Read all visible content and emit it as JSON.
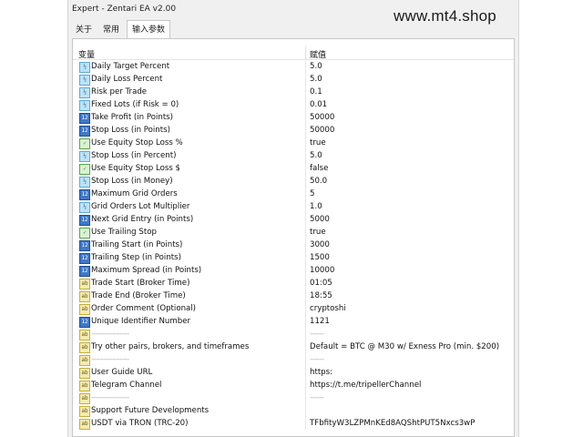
{
  "window": {
    "title": "Expert - Zentari EA v2.00"
  },
  "watermark": "www.mt4.shop",
  "tabs": [
    {
      "label": "关于"
    },
    {
      "label": "常用"
    },
    {
      "label": "输入参数"
    }
  ],
  "table": {
    "header": {
      "variable": "变量",
      "value": "赋值"
    },
    "rows": [
      {
        "icon": "double-icon",
        "name": "Daily Target Percent",
        "value": "5.0"
      },
      {
        "icon": "double-icon",
        "name": "Daily Loss Percent",
        "value": "5.0"
      },
      {
        "icon": "double-icon",
        "name": "Risk per Trade",
        "value": "0.1"
      },
      {
        "icon": "double-icon",
        "name": "Fixed Lots (if Risk = 0)",
        "value": "0.01"
      },
      {
        "icon": "integer-icon",
        "name": "Take Profit (in Points)",
        "value": "50000"
      },
      {
        "icon": "integer-icon",
        "name": "Stop Loss (in Points)",
        "value": "50000"
      },
      {
        "icon": "bool-icon",
        "name": "Use Equity Stop Loss %",
        "value": "true"
      },
      {
        "icon": "double-icon",
        "name": "Stop Loss (in Percent)",
        "value": "5.0"
      },
      {
        "icon": "bool-icon",
        "name": "Use Equity Stop Loss $",
        "value": "false"
      },
      {
        "icon": "double-icon",
        "name": "Stop Loss (in Money)",
        "value": "50.0"
      },
      {
        "icon": "integer-icon",
        "name": "Maximum Grid Orders",
        "value": "5"
      },
      {
        "icon": "double-icon",
        "name": "Grid Orders Lot Multiplier",
        "value": "1.0"
      },
      {
        "icon": "integer-icon",
        "name": "Next Grid Entry (in Points)",
        "value": "5000"
      },
      {
        "icon": "bool-icon",
        "name": "Use Trailing Stop",
        "value": "true"
      },
      {
        "icon": "integer-icon",
        "name": "Trailing Start (in Points)",
        "value": "3000"
      },
      {
        "icon": "integer-icon",
        "name": "Trailing Step (in Points)",
        "value": "1500"
      },
      {
        "icon": "integer-icon",
        "name": "Maximum Spread (in Points)",
        "value": "10000"
      },
      {
        "icon": "string-icon",
        "name": "Trade Start (Broker Time)",
        "value": "01:05"
      },
      {
        "icon": "string-icon",
        "name": "Trade End (Broker Time)",
        "value": "18:55"
      },
      {
        "icon": "string-icon",
        "name": "Order Comment (Optional)",
        "value": "cryptoshi"
      },
      {
        "icon": "integer-icon",
        "name": "Unique Identifier Number",
        "value": "1121"
      },
      {
        "icon": "string-icon",
        "name": "----------------",
        "value": "------"
      },
      {
        "icon": "string-icon",
        "name": "Try other pairs, brokers, and timeframes",
        "value": "Default = BTC @ M30 w/ Exness Pro (min. $200)"
      },
      {
        "icon": "string-icon",
        "name": "----------------",
        "value": "------"
      },
      {
        "icon": "string-icon",
        "name": "User Guide URL",
        "value": "https:"
      },
      {
        "icon": "string-icon",
        "name": "Telegram Channel",
        "value": "https://t.me/tripellerChannel"
      },
      {
        "icon": "string-icon",
        "name": "----------------",
        "value": "------"
      },
      {
        "icon": "string-icon",
        "name": "Support Future Developments",
        "value": ""
      },
      {
        "icon": "string-icon",
        "name": "USDT via TRON (TRC-20)",
        "value": "TFbfityW3LZPMnKEd8AQShtPUT5Nxcs3wP"
      }
    ]
  }
}
